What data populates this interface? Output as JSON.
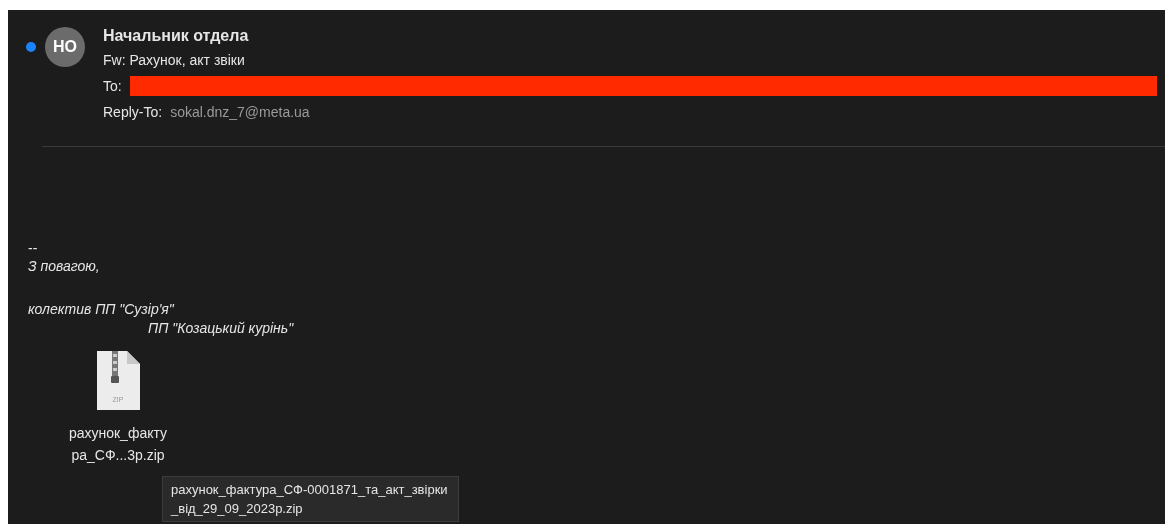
{
  "message": {
    "unread": true,
    "avatar_initials": "НО",
    "sender": "Начальник отдела",
    "subject": "Fw: Рахунок, акт звіки",
    "to": {
      "label": "To:",
      "redacted": true
    },
    "reply_to": {
      "label": "Reply-To:",
      "value": "sokal.dnz_7@meta.ua"
    }
  },
  "signature": [
    {
      "kind": "separator",
      "text": "--"
    },
    {
      "kind": "line",
      "text": "З повагою,"
    },
    {
      "kind": "paragraph",
      "text": "колектив ПП \"Сузір'я\""
    },
    {
      "kind": "indented",
      "text": "ПП \"Козацький курінь\""
    }
  ],
  "attachment": {
    "type": "ZIP",
    "label_lines": [
      "рахунок_факту",
      "ра_СФ...3р.zip"
    ],
    "tooltip_lines": [
      "рахунок_фактура_СФ-0001871_та_акт_звірки",
      "_від_29_09_2023р.zip"
    ]
  }
}
